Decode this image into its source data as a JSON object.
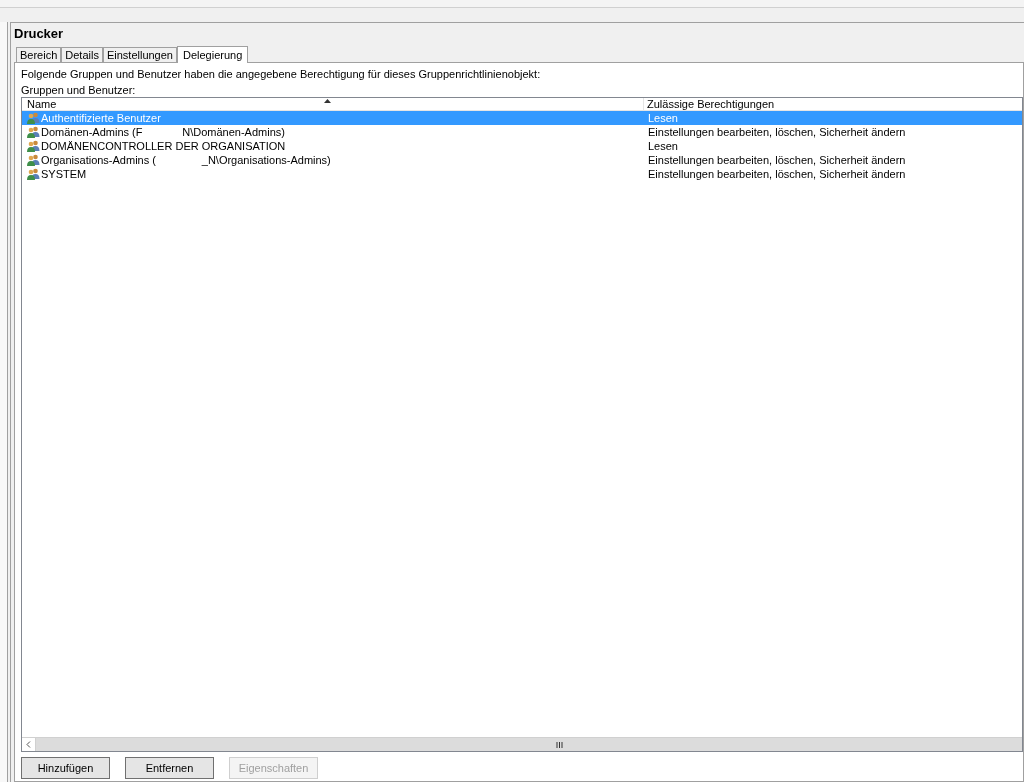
{
  "title": "Drucker",
  "tabs": [
    {
      "label": "Bereich",
      "selected": false
    },
    {
      "label": "Details",
      "selected": false
    },
    {
      "label": "Einstellungen",
      "selected": false
    },
    {
      "label": "Delegierung",
      "selected": true
    }
  ],
  "description": "Folgende Gruppen und Benutzer haben die angegebene Berechtigung für dieses Gruppenrichtlinienobjekt:",
  "list_label": "Gruppen und Benutzer:",
  "table": {
    "columns": [
      "Name",
      "Zulässige Berechtigungen"
    ],
    "rows": [
      {
        "name": "Authentifizierte Benutzer",
        "permission": "Lesen",
        "selected": true
      },
      {
        "name": "Domänen-Admins (F             N\\Domänen-Admins)",
        "permission": "Einstellungen bearbeiten, löschen, Sicherheit ändern",
        "selected": false
      },
      {
        "name": "DOMÄNENCONTROLLER DER ORGANISATION",
        "permission": "Lesen",
        "selected": false
      },
      {
        "name": "Organisations-Admins (               _N\\Organisations-Admins)",
        "permission": "Einstellungen bearbeiten, löschen, Sicherheit ändern",
        "selected": false
      },
      {
        "name": "SYSTEM",
        "permission": "Einstellungen bearbeiten, löschen, Sicherheit ändern",
        "selected": false
      }
    ]
  },
  "buttons": [
    {
      "label": "Hinzufügen",
      "disabled": false
    },
    {
      "label": "Entfernen",
      "disabled": false
    },
    {
      "label": "Eigenschaften",
      "disabled": true
    }
  ]
}
